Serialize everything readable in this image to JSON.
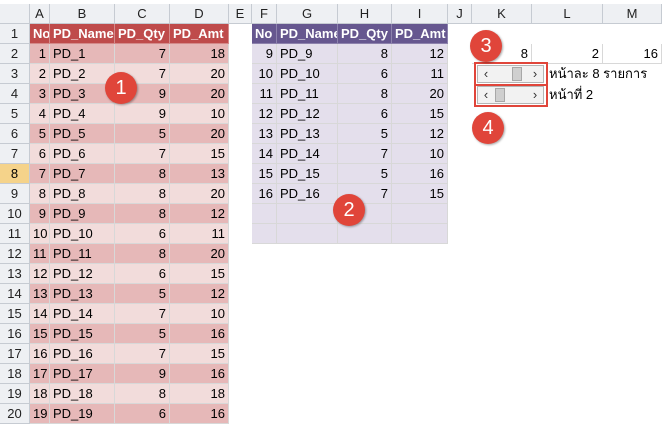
{
  "columns": [
    "A",
    "B",
    "C",
    "D",
    "E",
    "F",
    "G",
    "H",
    "I",
    "J",
    "K",
    "L",
    "M"
  ],
  "rows": [
    "1",
    "2",
    "3",
    "4",
    "5",
    "6",
    "7",
    "8",
    "9",
    "10",
    "11",
    "12",
    "13",
    "14",
    "15",
    "16",
    "17",
    "18",
    "19",
    "20"
  ],
  "selected_row": "8",
  "table1": {
    "headers": [
      "No",
      "PD_Name",
      "PD_Qty",
      "PD_Amt"
    ],
    "rows": [
      [
        "1",
        "PD_1",
        "7",
        "18"
      ],
      [
        "2",
        "PD_2",
        "7",
        "20"
      ],
      [
        "3",
        "PD_3",
        "9",
        "20"
      ],
      [
        "4",
        "PD_4",
        "9",
        "10"
      ],
      [
        "5",
        "PD_5",
        "5",
        "20"
      ],
      [
        "6",
        "PD_6",
        "7",
        "15"
      ],
      [
        "7",
        "PD_7",
        "8",
        "13"
      ],
      [
        "8",
        "PD_8",
        "8",
        "20"
      ],
      [
        "9",
        "PD_9",
        "8",
        "12"
      ],
      [
        "10",
        "PD_10",
        "6",
        "11"
      ],
      [
        "11",
        "PD_11",
        "8",
        "20"
      ],
      [
        "12",
        "PD_12",
        "6",
        "15"
      ],
      [
        "13",
        "PD_13",
        "5",
        "12"
      ],
      [
        "14",
        "PD_14",
        "7",
        "10"
      ],
      [
        "15",
        "PD_15",
        "5",
        "16"
      ],
      [
        "16",
        "PD_16",
        "7",
        "15"
      ],
      [
        "17",
        "PD_17",
        "9",
        "16"
      ],
      [
        "18",
        "PD_18",
        "8",
        "18"
      ],
      [
        "19",
        "PD_19",
        "6",
        "16"
      ]
    ]
  },
  "table2": {
    "headers": [
      "No",
      "PD_Name",
      "PD_Qty",
      "PD_Amt"
    ],
    "rows": [
      [
        "9",
        "PD_9",
        "8",
        "12"
      ],
      [
        "10",
        "PD_10",
        "6",
        "11"
      ],
      [
        "11",
        "PD_11",
        "8",
        "20"
      ],
      [
        "12",
        "PD_12",
        "6",
        "15"
      ],
      [
        "13",
        "PD_13",
        "5",
        "12"
      ],
      [
        "14",
        "PD_14",
        "7",
        "10"
      ],
      [
        "15",
        "PD_15",
        "5",
        "16"
      ],
      [
        "16",
        "PD_16",
        "7",
        "15"
      ]
    ]
  },
  "params": {
    "k2": "8",
    "l2": "2",
    "m2": "16"
  },
  "labels": {
    "per_page": "หน้าละ 8  รายการ",
    "page_no": "หน้าที่ 2"
  },
  "scrollbar_values": {
    "per_page": 8,
    "page": 2
  },
  "badges": [
    "1",
    "2",
    "3",
    "4"
  ],
  "colors": {
    "table1_header": "#bf4b4b",
    "table1_row_dark": "#e6b8b8",
    "table1_row_light": "#f2dcdb",
    "table2_header": "#66578f",
    "table2_row": "#e4dfec",
    "badge": "#e0453a",
    "selected_row_header": "#f5d38a"
  }
}
